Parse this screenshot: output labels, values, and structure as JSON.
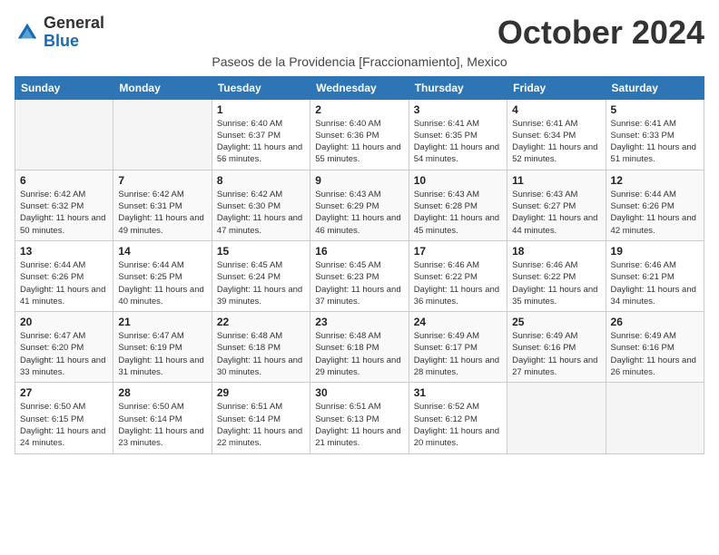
{
  "header": {
    "logo_general": "General",
    "logo_blue": "Blue",
    "month_title": "October 2024",
    "subtitle": "Paseos de la Providencia [Fraccionamiento], Mexico"
  },
  "days_of_week": [
    "Sunday",
    "Monday",
    "Tuesday",
    "Wednesday",
    "Thursday",
    "Friday",
    "Saturday"
  ],
  "weeks": [
    [
      {
        "day": "",
        "empty": true
      },
      {
        "day": "",
        "empty": true
      },
      {
        "day": "1",
        "sunrise": "Sunrise: 6:40 AM",
        "sunset": "Sunset: 6:37 PM",
        "daylight": "Daylight: 11 hours and 56 minutes."
      },
      {
        "day": "2",
        "sunrise": "Sunrise: 6:40 AM",
        "sunset": "Sunset: 6:36 PM",
        "daylight": "Daylight: 11 hours and 55 minutes."
      },
      {
        "day": "3",
        "sunrise": "Sunrise: 6:41 AM",
        "sunset": "Sunset: 6:35 PM",
        "daylight": "Daylight: 11 hours and 54 minutes."
      },
      {
        "day": "4",
        "sunrise": "Sunrise: 6:41 AM",
        "sunset": "Sunset: 6:34 PM",
        "daylight": "Daylight: 11 hours and 52 minutes."
      },
      {
        "day": "5",
        "sunrise": "Sunrise: 6:41 AM",
        "sunset": "Sunset: 6:33 PM",
        "daylight": "Daylight: 11 hours and 51 minutes."
      }
    ],
    [
      {
        "day": "6",
        "sunrise": "Sunrise: 6:42 AM",
        "sunset": "Sunset: 6:32 PM",
        "daylight": "Daylight: 11 hours and 50 minutes."
      },
      {
        "day": "7",
        "sunrise": "Sunrise: 6:42 AM",
        "sunset": "Sunset: 6:31 PM",
        "daylight": "Daylight: 11 hours and 49 minutes."
      },
      {
        "day": "8",
        "sunrise": "Sunrise: 6:42 AM",
        "sunset": "Sunset: 6:30 PM",
        "daylight": "Daylight: 11 hours and 47 minutes."
      },
      {
        "day": "9",
        "sunrise": "Sunrise: 6:43 AM",
        "sunset": "Sunset: 6:29 PM",
        "daylight": "Daylight: 11 hours and 46 minutes."
      },
      {
        "day": "10",
        "sunrise": "Sunrise: 6:43 AM",
        "sunset": "Sunset: 6:28 PM",
        "daylight": "Daylight: 11 hours and 45 minutes."
      },
      {
        "day": "11",
        "sunrise": "Sunrise: 6:43 AM",
        "sunset": "Sunset: 6:27 PM",
        "daylight": "Daylight: 11 hours and 44 minutes."
      },
      {
        "day": "12",
        "sunrise": "Sunrise: 6:44 AM",
        "sunset": "Sunset: 6:26 PM",
        "daylight": "Daylight: 11 hours and 42 minutes."
      }
    ],
    [
      {
        "day": "13",
        "sunrise": "Sunrise: 6:44 AM",
        "sunset": "Sunset: 6:26 PM",
        "daylight": "Daylight: 11 hours and 41 minutes."
      },
      {
        "day": "14",
        "sunrise": "Sunrise: 6:44 AM",
        "sunset": "Sunset: 6:25 PM",
        "daylight": "Daylight: 11 hours and 40 minutes."
      },
      {
        "day": "15",
        "sunrise": "Sunrise: 6:45 AM",
        "sunset": "Sunset: 6:24 PM",
        "daylight": "Daylight: 11 hours and 39 minutes."
      },
      {
        "day": "16",
        "sunrise": "Sunrise: 6:45 AM",
        "sunset": "Sunset: 6:23 PM",
        "daylight": "Daylight: 11 hours and 37 minutes."
      },
      {
        "day": "17",
        "sunrise": "Sunrise: 6:46 AM",
        "sunset": "Sunset: 6:22 PM",
        "daylight": "Daylight: 11 hours and 36 minutes."
      },
      {
        "day": "18",
        "sunrise": "Sunrise: 6:46 AM",
        "sunset": "Sunset: 6:22 PM",
        "daylight": "Daylight: 11 hours and 35 minutes."
      },
      {
        "day": "19",
        "sunrise": "Sunrise: 6:46 AM",
        "sunset": "Sunset: 6:21 PM",
        "daylight": "Daylight: 11 hours and 34 minutes."
      }
    ],
    [
      {
        "day": "20",
        "sunrise": "Sunrise: 6:47 AM",
        "sunset": "Sunset: 6:20 PM",
        "daylight": "Daylight: 11 hours and 33 minutes."
      },
      {
        "day": "21",
        "sunrise": "Sunrise: 6:47 AM",
        "sunset": "Sunset: 6:19 PM",
        "daylight": "Daylight: 11 hours and 31 minutes."
      },
      {
        "day": "22",
        "sunrise": "Sunrise: 6:48 AM",
        "sunset": "Sunset: 6:18 PM",
        "daylight": "Daylight: 11 hours and 30 minutes."
      },
      {
        "day": "23",
        "sunrise": "Sunrise: 6:48 AM",
        "sunset": "Sunset: 6:18 PM",
        "daylight": "Daylight: 11 hours and 29 minutes."
      },
      {
        "day": "24",
        "sunrise": "Sunrise: 6:49 AM",
        "sunset": "Sunset: 6:17 PM",
        "daylight": "Daylight: 11 hours and 28 minutes."
      },
      {
        "day": "25",
        "sunrise": "Sunrise: 6:49 AM",
        "sunset": "Sunset: 6:16 PM",
        "daylight": "Daylight: 11 hours and 27 minutes."
      },
      {
        "day": "26",
        "sunrise": "Sunrise: 6:49 AM",
        "sunset": "Sunset: 6:16 PM",
        "daylight": "Daylight: 11 hours and 26 minutes."
      }
    ],
    [
      {
        "day": "27",
        "sunrise": "Sunrise: 6:50 AM",
        "sunset": "Sunset: 6:15 PM",
        "daylight": "Daylight: 11 hours and 24 minutes."
      },
      {
        "day": "28",
        "sunrise": "Sunrise: 6:50 AM",
        "sunset": "Sunset: 6:14 PM",
        "daylight": "Daylight: 11 hours and 23 minutes."
      },
      {
        "day": "29",
        "sunrise": "Sunrise: 6:51 AM",
        "sunset": "Sunset: 6:14 PM",
        "daylight": "Daylight: 11 hours and 22 minutes."
      },
      {
        "day": "30",
        "sunrise": "Sunrise: 6:51 AM",
        "sunset": "Sunset: 6:13 PM",
        "daylight": "Daylight: 11 hours and 21 minutes."
      },
      {
        "day": "31",
        "sunrise": "Sunrise: 6:52 AM",
        "sunset": "Sunset: 6:12 PM",
        "daylight": "Daylight: 11 hours and 20 minutes."
      },
      {
        "day": "",
        "empty": true
      },
      {
        "day": "",
        "empty": true
      }
    ]
  ]
}
